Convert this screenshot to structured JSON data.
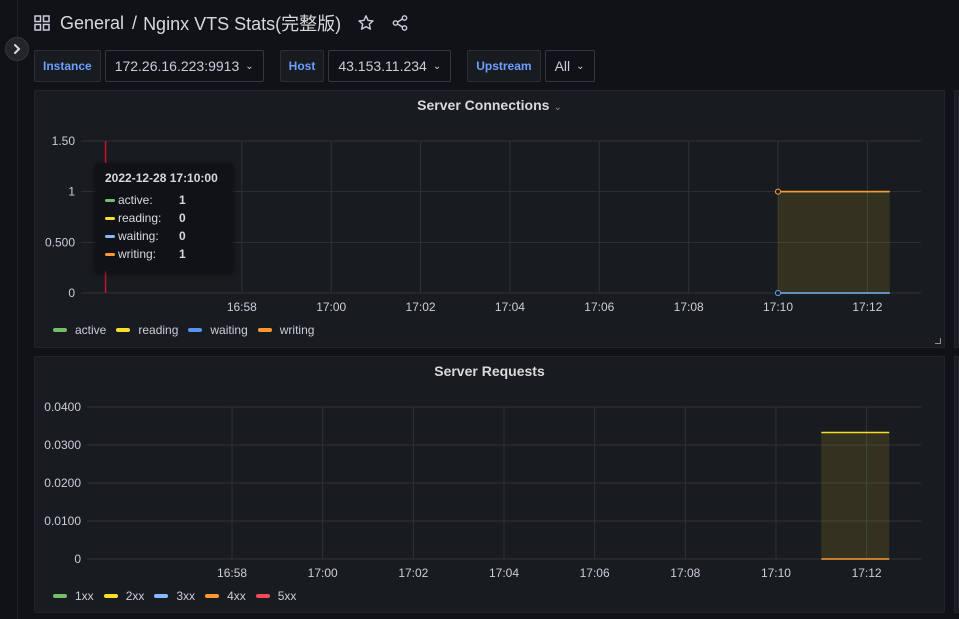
{
  "header": {
    "folder": "General",
    "separator": "/",
    "title": "Nginx VTS Stats(完整版)"
  },
  "variables": [
    {
      "label": "Instance",
      "value": "172.26.16.223:9913"
    },
    {
      "label": "Host",
      "value": "43.153.11.234"
    },
    {
      "label": "Upstream",
      "value": "All"
    }
  ],
  "panels": {
    "connections": {
      "title": "Server Connections",
      "legend": [
        {
          "name": "active",
          "color": "#73bf69"
        },
        {
          "name": "reading",
          "color": "#fade2a"
        },
        {
          "name": "waiting",
          "color": "#5794f2"
        },
        {
          "name": "writing",
          "color": "#ff9830"
        }
      ],
      "tooltip": {
        "time": "2022-12-28 17:10:00",
        "rows": [
          {
            "name": "active:",
            "value": "1",
            "color": "#73bf69"
          },
          {
            "name": "reading:",
            "value": "0",
            "color": "#fade2a"
          },
          {
            "name": "waiting:",
            "value": "0",
            "color": "#8ab8ff"
          },
          {
            "name": "writing:",
            "value": "1",
            "color": "#ff9830"
          }
        ]
      }
    },
    "requests": {
      "title": "Server Requests",
      "legend": [
        {
          "name": "1xx",
          "color": "#73bf69"
        },
        {
          "name": "2xx",
          "color": "#fade2a"
        },
        {
          "name": "3xx",
          "color": "#8ab8ff"
        },
        {
          "name": "4xx",
          "color": "#ff9830"
        },
        {
          "name": "5xx",
          "color": "#f2495c"
        }
      ]
    }
  },
  "chart_data": [
    {
      "type": "area",
      "title": "Server Connections",
      "x_ticks": [
        "16:58",
        "17:00",
        "17:02",
        "17:04",
        "17:06",
        "17:08",
        "17:10",
        "17:12"
      ],
      "y_ticks": [
        "0",
        "0.500",
        "1",
        "1.50"
      ],
      "ylim": [
        0,
        1.5
      ],
      "xlim_minutes": [
        16.9,
        27.3
      ],
      "x_tick_minutes": [
        18,
        20,
        22,
        24,
        26,
        28,
        30,
        32
      ],
      "x_start": "16:56:30",
      "cursor_minute": 17.0,
      "series": [
        {
          "name": "active",
          "color": "#73bf69",
          "points": [
            [
              30,
              1
            ],
            [
              32.5,
              1
            ]
          ]
        },
        {
          "name": "reading",
          "color": "#fade2a",
          "points": [
            [
              30,
              0
            ],
            [
              32.5,
              0
            ]
          ]
        },
        {
          "name": "waiting",
          "color": "#5794f2",
          "points": [
            [
              30,
              0
            ],
            [
              32.5,
              0
            ]
          ]
        },
        {
          "name": "writing",
          "color": "#ff9830",
          "points": [
            [
              30,
              1
            ],
            [
              32.5,
              1
            ]
          ]
        }
      ]
    },
    {
      "type": "area",
      "title": "Server Requests",
      "x_ticks": [
        "16:58",
        "17:00",
        "17:02",
        "17:04",
        "17:06",
        "17:08",
        "17:10",
        "17:12"
      ],
      "y_ticks": [
        "0",
        "0.0100",
        "0.0200",
        "0.0300",
        "0.0400"
      ],
      "ylim": [
        0,
        0.04
      ],
      "series": [
        {
          "name": "1xx",
          "color": "#73bf69",
          "points": []
        },
        {
          "name": "2xx",
          "color": "#fade2a",
          "points": [
            [
              31,
              0.0333
            ],
            [
              32.5,
              0.0333
            ]
          ]
        },
        {
          "name": "3xx",
          "color": "#8ab8ff",
          "points": []
        },
        {
          "name": "4xx",
          "color": "#ff9830",
          "points": [
            [
              31,
              0
            ],
            [
              32.5,
              0
            ]
          ]
        },
        {
          "name": "5xx",
          "color": "#f2495c",
          "points": []
        }
      ]
    }
  ]
}
